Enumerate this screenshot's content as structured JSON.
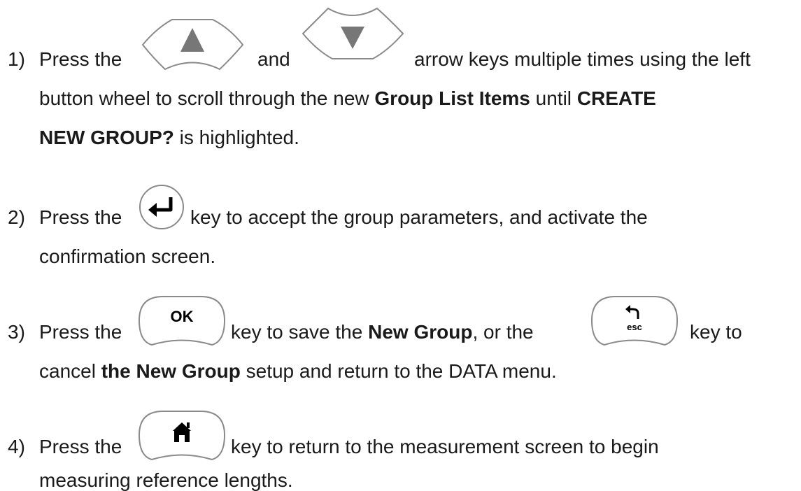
{
  "steps": [
    {
      "number": "1)",
      "line1": {
        "pre": "Press the",
        "between": "and",
        "post": "arrow keys multiple times using the left"
      },
      "line2": {
        "pre": "button wheel to scroll through the new ",
        "b1": "Group List Items",
        "mid": " until ",
        "b2": "CREATE"
      },
      "line3": {
        "b1": "NEW GROUP?",
        "post": " is highlighted."
      },
      "icons": [
        "up-arrow-key-icon",
        "down-arrow-key-icon"
      ]
    },
    {
      "number": "2)",
      "line1": {
        "pre": "Press the",
        "post": "key to accept the group parameters, and activate the"
      },
      "line2": {
        "text": "confirmation screen."
      },
      "icons": [
        "enter-key-icon"
      ]
    },
    {
      "number": "3)",
      "line1": {
        "pre": "Press the",
        "mid1": "key to save the ",
        "b1": "New Group",
        "mid2": ", or the",
        "post": "key to"
      },
      "line2": {
        "pre": "cancel ",
        "b1": "the New Group",
        "post": " setup and return to the DATA menu."
      },
      "icons": [
        "ok-key-icon",
        "esc-key-icon"
      ],
      "ok_label": "OK",
      "esc_label": "esc"
    },
    {
      "number": "4)",
      "line1": {
        "pre": "Press the",
        "post": "key to return to the measurement screen to begin"
      },
      "line2": {
        "text": "measuring reference lengths."
      },
      "icons": [
        "home-key-icon"
      ]
    }
  ]
}
